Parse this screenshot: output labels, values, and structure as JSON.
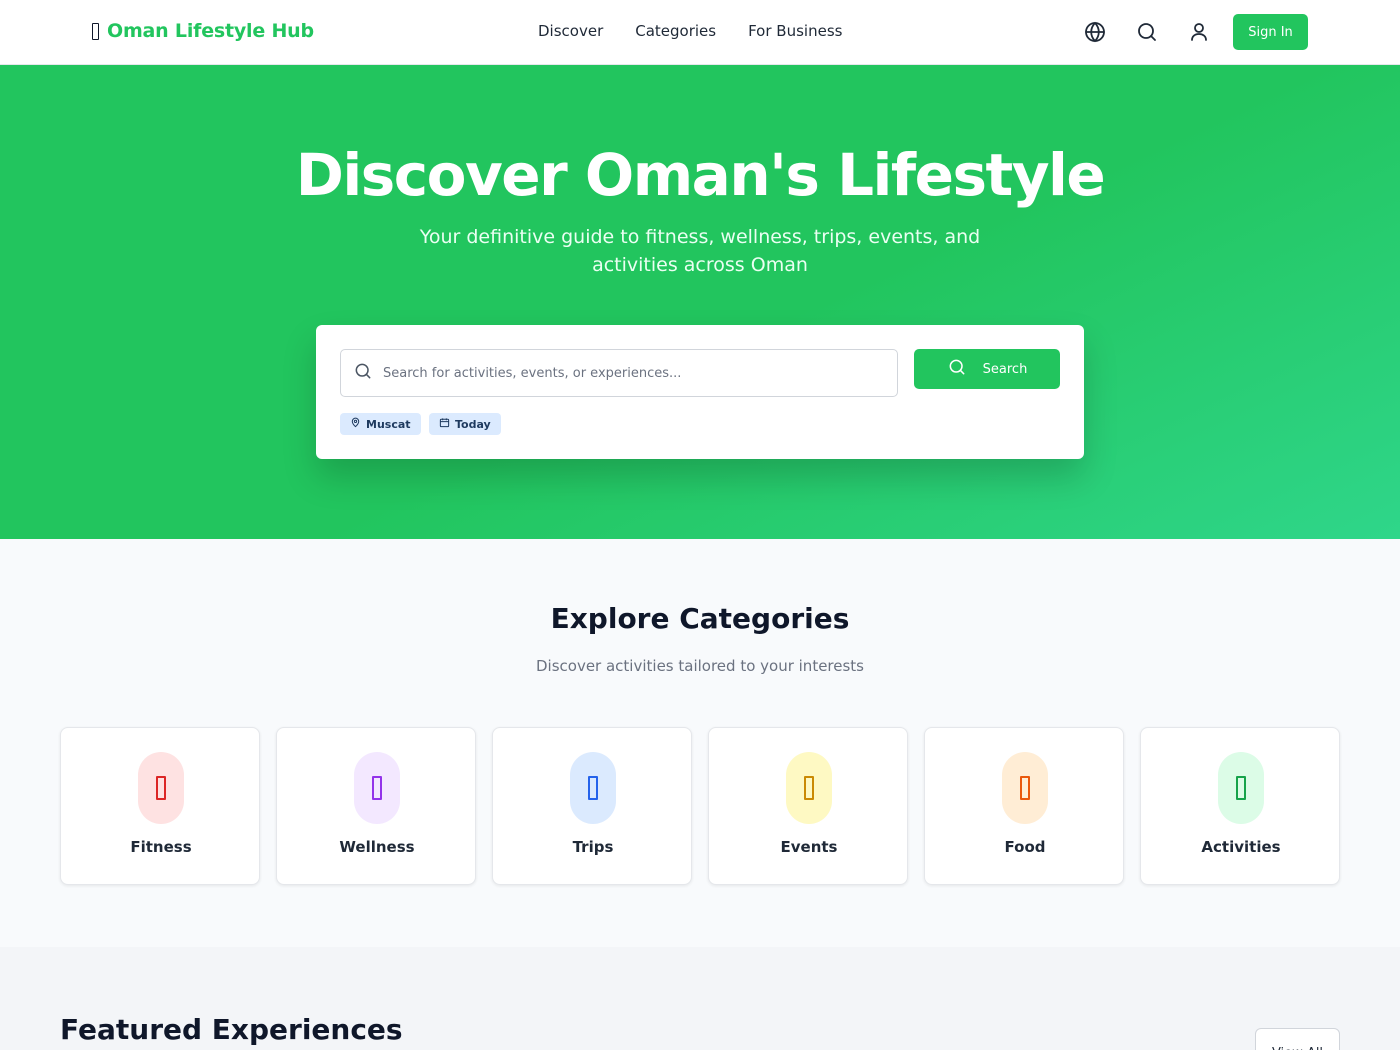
{
  "header": {
    "brand": "Oman Lifestyle Hub",
    "brand_color": "#22c55e",
    "nav": [
      "Discover",
      "Categories",
      "For Business"
    ],
    "icons": [
      "globe-icon",
      "search-icon",
      "user-icon"
    ],
    "signin_label": "Sign In"
  },
  "hero": {
    "title": "Discover Oman's Lifestyle",
    "subtitle": "Your definitive guide to fitness, wellness, trips, events, and activities across Oman",
    "search": {
      "placeholder": "Search for activities, events, or experiences...",
      "value": "",
      "button_label": "Search"
    },
    "chips": [
      {
        "label": "Muscat",
        "icon": "map-pin-icon"
      },
      {
        "label": "Today",
        "icon": "calendar-icon"
      }
    ]
  },
  "categories": {
    "title": "Explore Categories",
    "subtitle": "Discover activities tailored to your interests",
    "items": [
      {
        "label": "Fitness",
        "bg": "#fee2e2",
        "fg": "#dc2626"
      },
      {
        "label": "Wellness",
        "bg": "#f3e8ff",
        "fg": "#9333ea"
      },
      {
        "label": "Trips",
        "bg": "#dbeafe",
        "fg": "#2563eb"
      },
      {
        "label": "Events",
        "bg": "#fef9c3",
        "fg": "#ca8a04"
      },
      {
        "label": "Food",
        "bg": "#ffedd5",
        "fg": "#ea580c"
      },
      {
        "label": "Activities",
        "bg": "#dcfce7",
        "fg": "#16a34a"
      }
    ]
  },
  "featured": {
    "title": "Featured Experiences",
    "view_all_label": "View All"
  }
}
